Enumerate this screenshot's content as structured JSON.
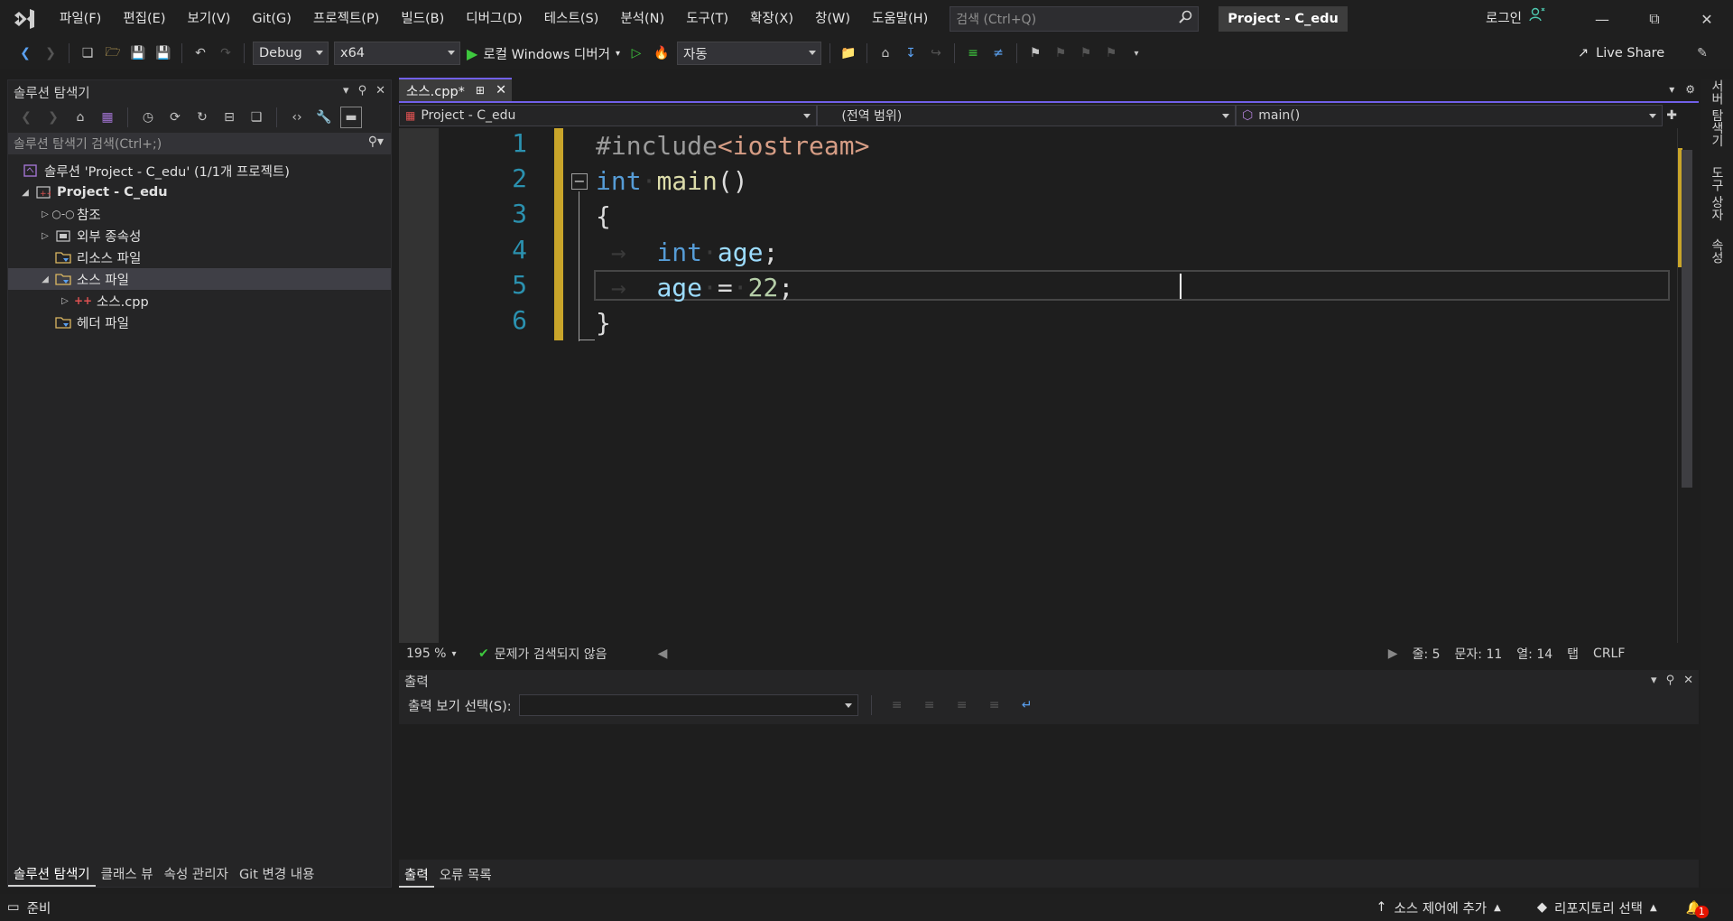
{
  "menu": {
    "items": [
      "파일(F)",
      "편집(E)",
      "보기(V)",
      "Git(G)",
      "프로젝트(P)",
      "빌드(B)",
      "디버그(D)",
      "테스트(S)",
      "분석(N)",
      "도구(T)",
      "확장(X)",
      "창(W)",
      "도움말(H)"
    ],
    "search_placeholder": "검색 (Ctrl+Q)",
    "project_title": "Project - C_edu",
    "login": "로그인"
  },
  "toolbar": {
    "config": "Debug",
    "platform": "x64",
    "debugger": "로컬 Windows 디버거",
    "stack_frame": "자동",
    "live_share": "Live Share"
  },
  "solution_explorer": {
    "title": "솔루션 탐색기",
    "search_placeholder": "솔루션 탐색기 검색(Ctrl+;)",
    "tree": {
      "solution": "솔루션 'Project - C_edu' (1/1개 프로젝트)",
      "project": "Project - C_edu",
      "references": "참조",
      "external": "외부 종속성",
      "resources": "리소스 파일",
      "sources": "소스 파일",
      "source_file": "소스.cpp",
      "headers": "헤더 파일"
    },
    "bottom_tabs": [
      "솔루션 탐색기",
      "클래스 뷰",
      "속성 관리자",
      "Git 변경 내용"
    ]
  },
  "editor": {
    "tab_label": "소스.cpp*",
    "nav_project": "Project - C_edu",
    "nav_scope": "(전역 범위)",
    "nav_member": "main()",
    "line_numbers": [
      "1",
      "2",
      "3",
      "4",
      "5",
      "6"
    ],
    "code": {
      "line1_directive": "#include",
      "line1_header": "<iostream>",
      "line2_type": "int",
      "line2_fn": "main",
      "line2_parens": "()",
      "line3": "{",
      "line4_type": "int",
      "line4_var": "age",
      "line4_semi": ";",
      "line5_var": "age",
      "line5_op": "=",
      "line5_num": "22",
      "line5_semi": ";",
      "line6": "}"
    },
    "zoom": "195 %",
    "issues": "문제가 검색되지 않음",
    "line": "줄: 5",
    "char": "문자: 11",
    "col": "열: 14",
    "indent": "탭",
    "eol": "CRLF"
  },
  "output": {
    "title": "출력",
    "source_label": "출력 보기 선택(S):",
    "bottom_tabs": [
      "출력",
      "오류 목록"
    ]
  },
  "right_sidebar": [
    "서버 탐색기",
    "도구 상자",
    "속성"
  ],
  "status": {
    "ready": "준비",
    "source_control": "소스 제어에 추가",
    "repository": "리포지토리 선택",
    "notifications": "1"
  },
  "colors": {
    "accent": "#7160e8",
    "change_marker": "#c9a52a",
    "line_number": "#2b91af",
    "keyword": "#569cd6"
  }
}
